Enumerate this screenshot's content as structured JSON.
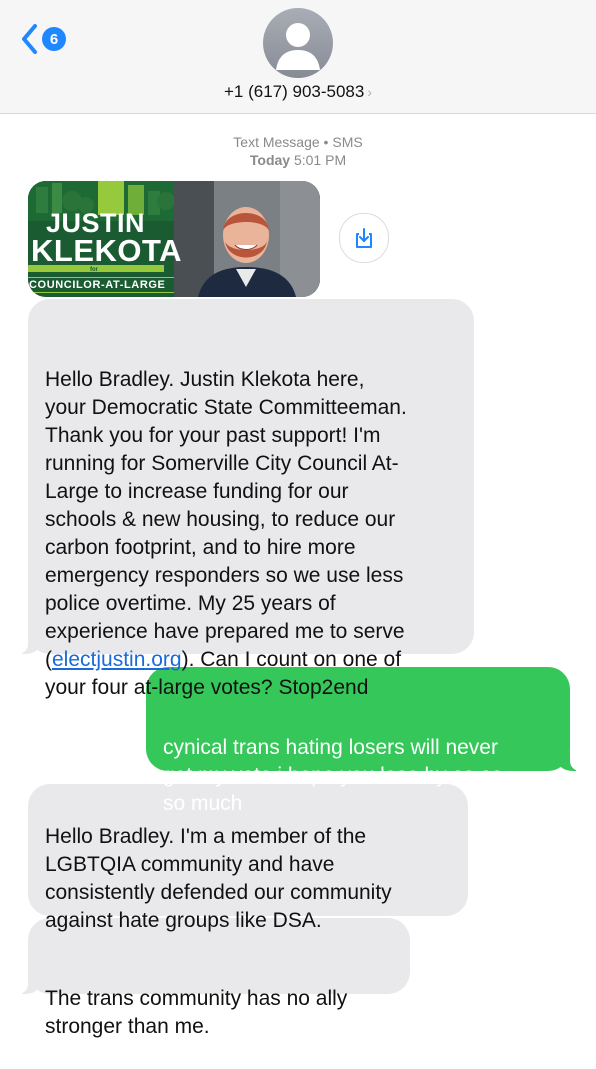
{
  "header": {
    "unread_count": "6",
    "contact_number": "+1 (617) 903-5083",
    "chevron": "›"
  },
  "thread": {
    "service_label": "Text Message • SMS",
    "day": "Today",
    "time": "5:01 PM"
  },
  "card": {
    "name_first": "JUSTIN",
    "name_last": "KLEKOTA",
    "for_label": "for",
    "office": "COUNCILOR-AT-LARGE",
    "colors": {
      "green": "#1b5b31",
      "lime": "#97c93d"
    }
  },
  "messages": [
    {
      "direction": "incoming",
      "text_before_link": "Hello Bradley.  Justin Klekota here,\nyour Democratic State Committeeman.\nThank you for your past support!  I'm\nrunning for Somerville City Council At-\nLarge to increase funding for our\nschools & new housing, to reduce our\ncarbon footprint, and to hire more\nemergency responders so we use less\npolice overtime.  My 25 years of\nexperience have prepared me to serve\n(",
      "link": "electjustin.org",
      "text_after_link": ").  Can I count on one of\nyour four at-large votes?  Stop2end"
    },
    {
      "direction": "outgoing",
      "text": "cynical trans hating losers will never\nget my vote i hope you lose by so so\nso much"
    },
    {
      "direction": "incoming",
      "text": "Hello Bradley.   I'm a member of the\nLGBTQIA community and have\nconsistently defended our community\nagainst hate groups like DSA."
    },
    {
      "direction": "incoming",
      "text": "The trans community has no ally\nstronger than me."
    }
  ],
  "icons": {
    "back": "chevron-left-icon",
    "avatar": "person-silhouette-icon",
    "save": "download-icon"
  },
  "colors": {
    "accent": "#1f87ff",
    "incoming_bubble": "#e9e9eb",
    "outgoing_bubble": "#35c759",
    "link": "#1a6ad9"
  }
}
